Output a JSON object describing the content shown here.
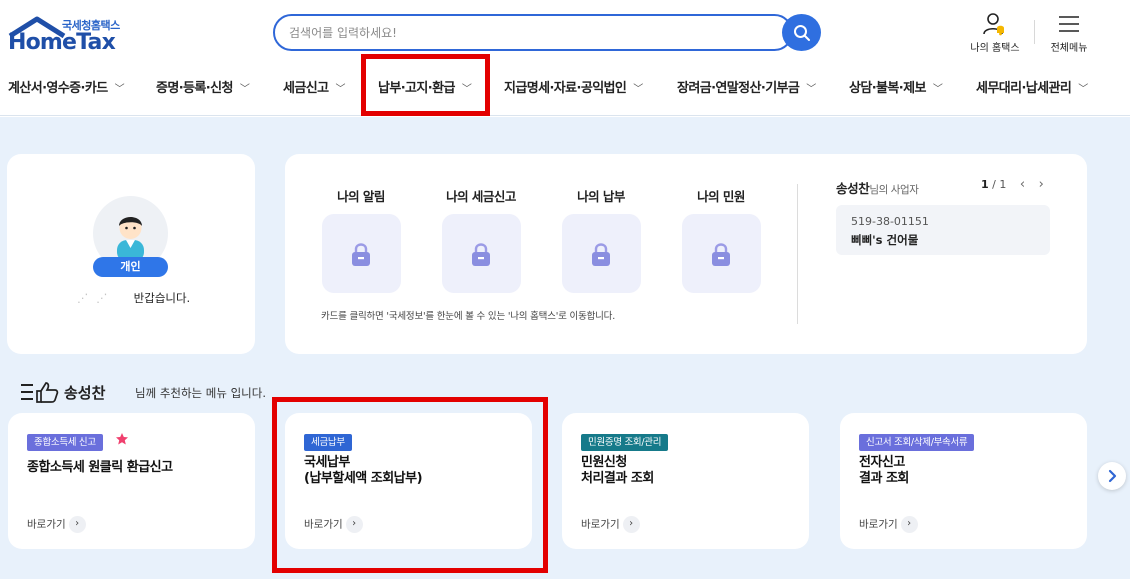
{
  "logo": {
    "sub": "국세청홈택스",
    "main": "HomeTax"
  },
  "search": {
    "placeholder": "검색어를 입력하세요!"
  },
  "util": {
    "my_hometax": "나의 홈택스",
    "all_menu": "전체메뉴"
  },
  "gnb": [
    {
      "label": "계산서·영수증·카드"
    },
    {
      "label": "증명·등록·신청"
    },
    {
      "label": "세금신고"
    },
    {
      "label": "납부·고지·환급"
    },
    {
      "label": "지급명세·자료·공익법인"
    },
    {
      "label": "장려금·연말정산·기부금"
    },
    {
      "label": "상담·불복·제보"
    },
    {
      "label": "세무대리·납세관리"
    }
  ],
  "profile": {
    "badge": "개인",
    "greeting": "반갑습니다."
  },
  "my_menu": {
    "items": [
      {
        "label": "나의 알림"
      },
      {
        "label": "나의 세금신고"
      },
      {
        "label": "나의 납부"
      },
      {
        "label": "나의 민원"
      }
    ],
    "hint": "카드를 클릭하면 '국세정보'를 한눈에 볼 수 있는 '나의 홈택스'로 이동합니다."
  },
  "business": {
    "owner": "송성찬",
    "suffix": "님의 사업자",
    "page_current": "1",
    "page_total": "/ 1",
    "number": "519-38-01151",
    "name": "삐삐's 건어물"
  },
  "recommend": {
    "name": "송성찬",
    "rest": "님께 추천하는 메뉴 입니다.",
    "cards": [
      {
        "tag": "종합소득세 신고",
        "tag_color": "#6a6fdc",
        "title1": "종합소득세 원클릭 환급신고",
        "title2": "",
        "go": "바로가기",
        "starred": true
      },
      {
        "tag": "세금납부",
        "tag_color": "#2f66d4",
        "title1": "국세납부",
        "title2": "(납부할세액 조회납부)",
        "go": "바로가기",
        "starred": false
      },
      {
        "tag": "민원증명 조회/관리",
        "tag_color": "#167a8a",
        "title1": "민원신청",
        "title2": "처리결과 조회",
        "go": "바로가기",
        "starred": false
      },
      {
        "tag": "신고서 조회/삭제/부속서류",
        "tag_color": "#6a6fdc",
        "title1": "전자신고",
        "title2": "결과 조회",
        "go": "바로가기",
        "starred": false
      }
    ]
  },
  "colors": {
    "brand": "#1f4fa8",
    "accent": "#2f6fe0",
    "highlight": "#e30000",
    "background": "#e8f1fb"
  }
}
